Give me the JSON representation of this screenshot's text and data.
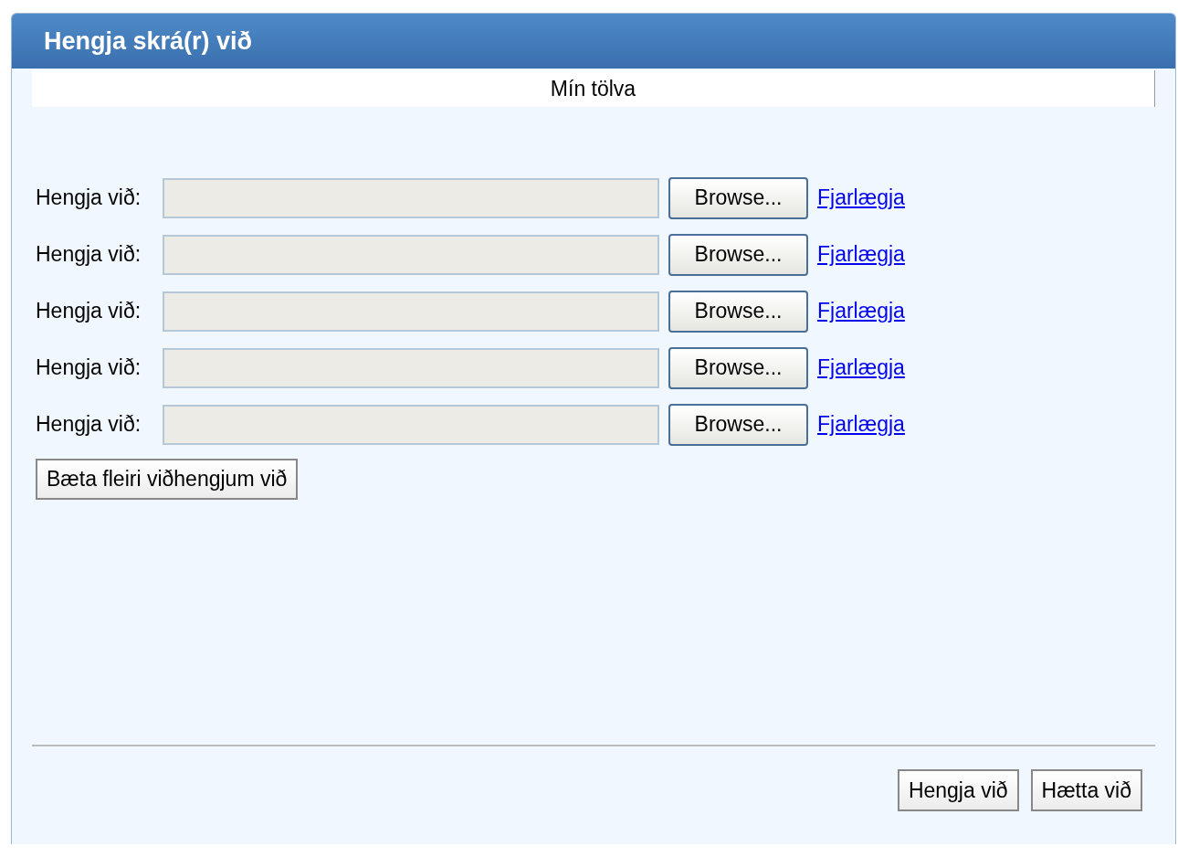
{
  "dialog": {
    "title": "Hengja skrá(r) við"
  },
  "tabs": [
    {
      "label": "Mín tölva",
      "selected": true
    }
  ],
  "attachments": [
    {
      "label": "Hengja við:",
      "button": "Browse...",
      "link": "Fjarlægja"
    },
    {
      "label": "Hengja við:",
      "button": "Browse...",
      "link": "Fjarlægja"
    },
    {
      "label": "Hengja við:",
      "button": "Browse...",
      "link": "Fjarlægja"
    },
    {
      "label": "Hengja við:",
      "button": "Browse...",
      "link": "Fjarlægja"
    },
    {
      "label": "Hengja við:",
      "button": "Browse...",
      "link": "Fjarlægja"
    }
  ],
  "add_button": "Bæta fleiri viðhengjum við",
  "buttons": [
    "Hengja við",
    "Hætta við"
  ]
}
